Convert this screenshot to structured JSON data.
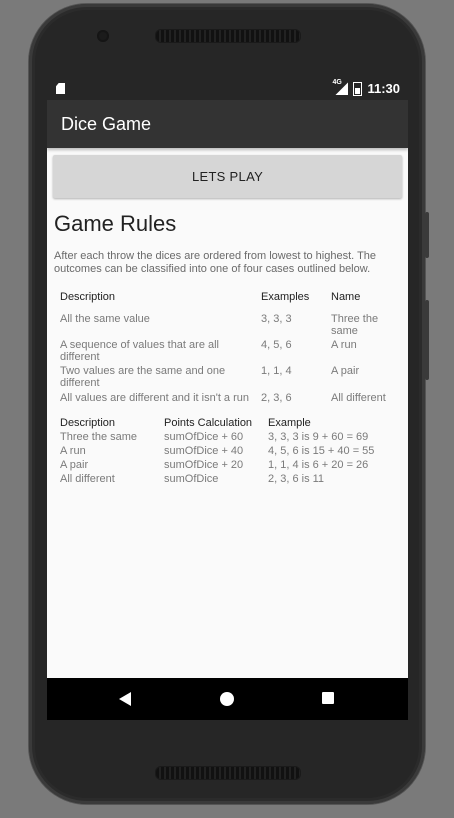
{
  "statusbar": {
    "network": "4G",
    "time": "11:30",
    "icons": [
      "sd-card-icon",
      "signal-icon",
      "battery-icon"
    ]
  },
  "appbar": {
    "title": "Dice Game"
  },
  "play_button": {
    "label": "LETS PLAY"
  },
  "rules": {
    "title": "Game Rules",
    "intro": "After each throw the dices are ordered from lowest to highest. The outcomes can be classified into one of four cases outlined below."
  },
  "cases_table": {
    "headers": [
      "Description",
      "Examples",
      "Name"
    ],
    "rows": [
      [
        "All the same value",
        "3, 3, 3",
        "Three the same"
      ],
      [
        "A sequence of values that are all different",
        "4, 5, 6",
        "A run"
      ],
      [
        "Two values are the same and one different",
        "1, 1, 4",
        "A pair"
      ],
      [
        "All values are different and it isn't a run",
        "2, 3, 6",
        "All different"
      ]
    ]
  },
  "points_table": {
    "headers": [
      "Description",
      "Points Calculation",
      "Example"
    ],
    "rows": [
      [
        "Three the same",
        "sumOfDice + 60",
        "3, 3, 3 is 9 + 60 = 69"
      ],
      [
        "A run",
        "sumOfDice + 40",
        "4, 5, 6 is 15 + 40 = 55"
      ],
      [
        "A pair",
        "sumOfDice + 20",
        "1, 1, 4 is 6 + 20 = 26"
      ],
      [
        "All different",
        "sumOfDice",
        "2, 3, 6 is 11"
      ]
    ]
  },
  "colors": {
    "appbar": "#333333",
    "button": "#d6d6d6",
    "screen": "#fafafa"
  }
}
